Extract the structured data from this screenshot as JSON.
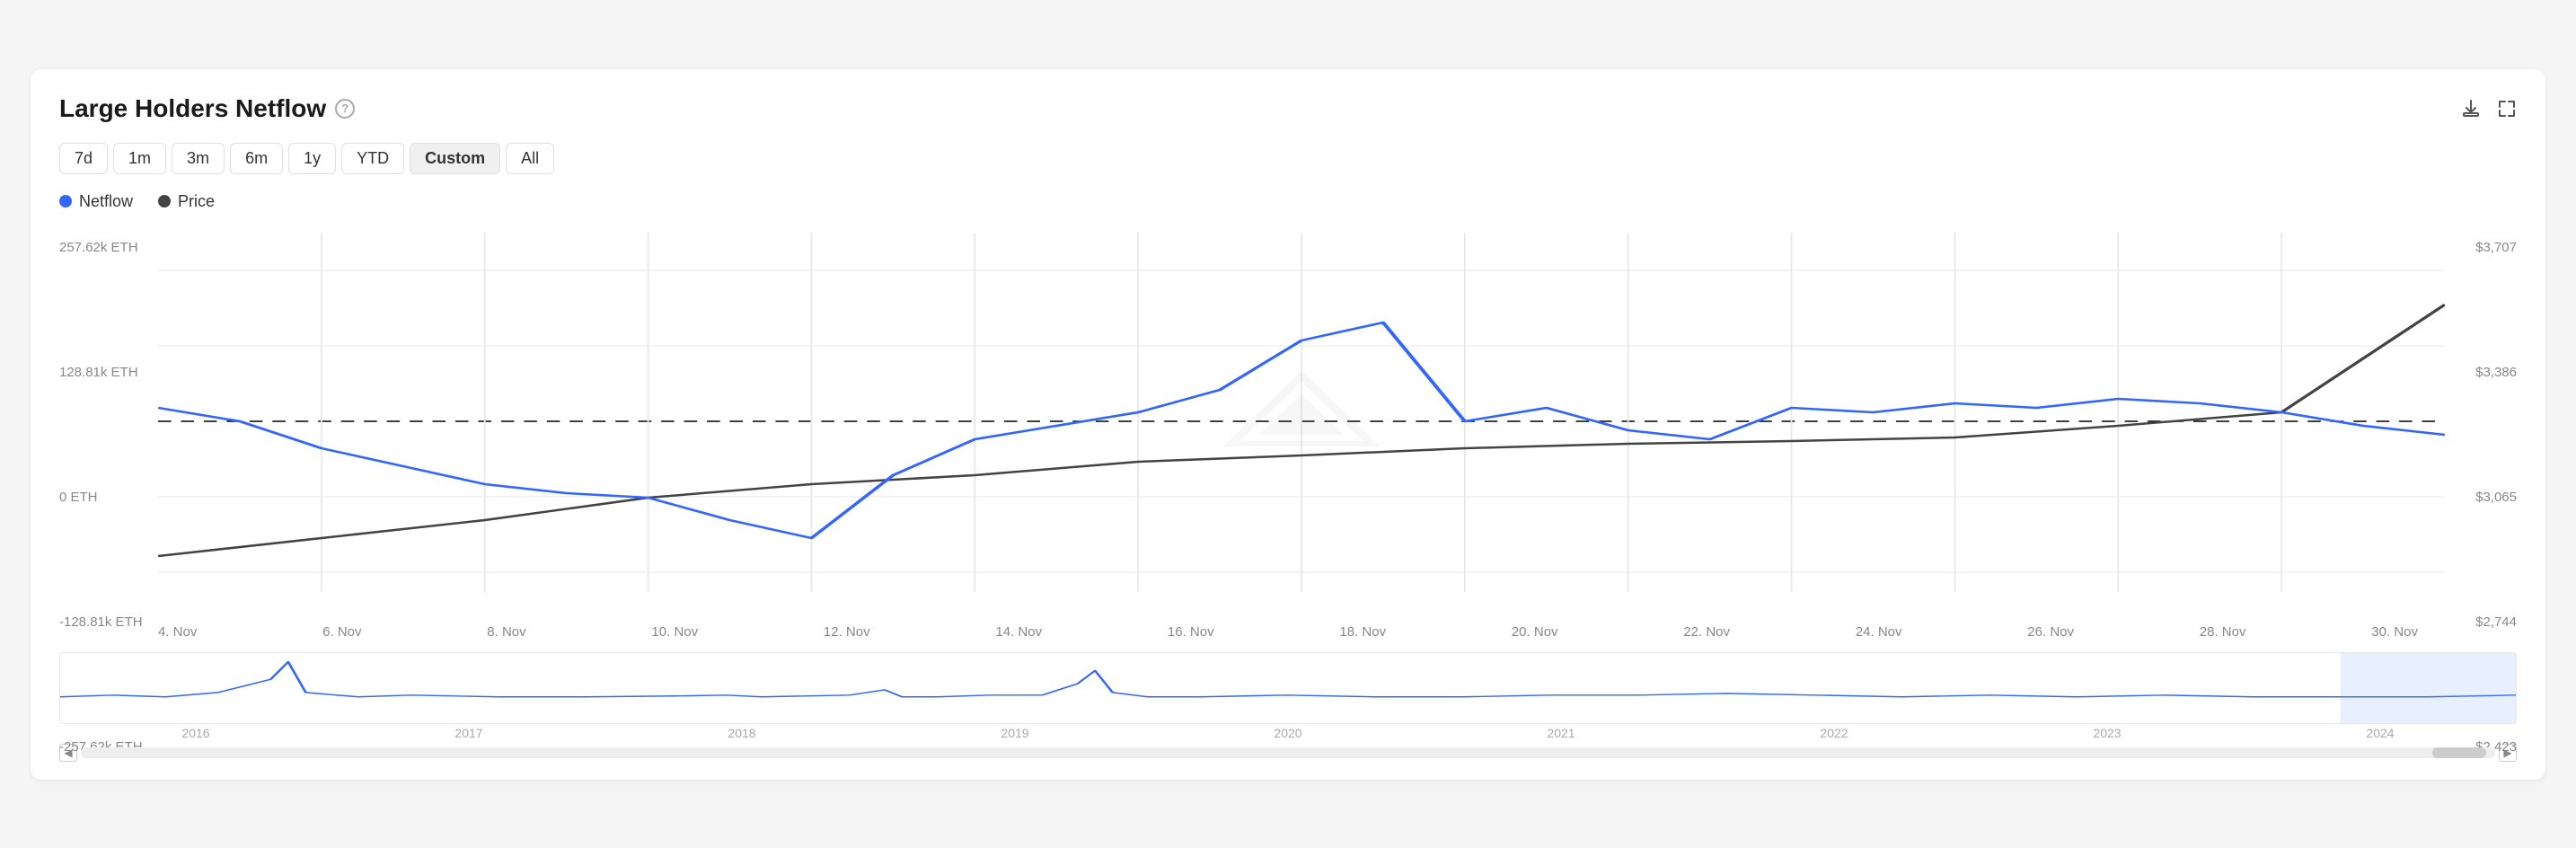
{
  "header": {
    "title": "Large Holders Netflow",
    "help_tooltip": "?",
    "download_label": "download",
    "expand_label": "expand"
  },
  "time_filters": [
    {
      "label": "7d",
      "id": "7d"
    },
    {
      "label": "1m",
      "id": "1m"
    },
    {
      "label": "3m",
      "id": "3m"
    },
    {
      "label": "6m",
      "id": "6m"
    },
    {
      "label": "1y",
      "id": "1y"
    },
    {
      "label": "YTD",
      "id": "ytd"
    },
    {
      "label": "Custom",
      "id": "custom",
      "active": true
    },
    {
      "label": "All",
      "id": "all"
    }
  ],
  "legend": [
    {
      "label": "Netflow",
      "color": "#3366ff"
    },
    {
      "label": "Price",
      "color": "#444444"
    }
  ],
  "y_labels_left": [
    "257.62k ETH",
    "128.81k ETH",
    "0 ETH",
    "-128.81k ETH",
    "-257.62k ETH"
  ],
  "y_labels_right": [
    "$3,707",
    "$3,386",
    "$3,065",
    "$2,744",
    "$2,423"
  ],
  "x_labels": [
    "4. Nov",
    "6. Nov",
    "8. Nov",
    "10. Nov",
    "12. Nov",
    "14. Nov",
    "16. Nov",
    "18. Nov",
    "20. Nov",
    "22. Nov",
    "24. Nov",
    "26. Nov",
    "28. Nov",
    "30. Nov"
  ],
  "mini_x_labels": [
    "2016",
    "2017",
    "2018",
    "2019",
    "2020",
    "2021",
    "2022",
    "2023",
    "2024"
  ],
  "colors": {
    "netflow": "#3366ff",
    "price": "#444444",
    "zero_line": "#000000",
    "grid": "#e8e8e8"
  }
}
